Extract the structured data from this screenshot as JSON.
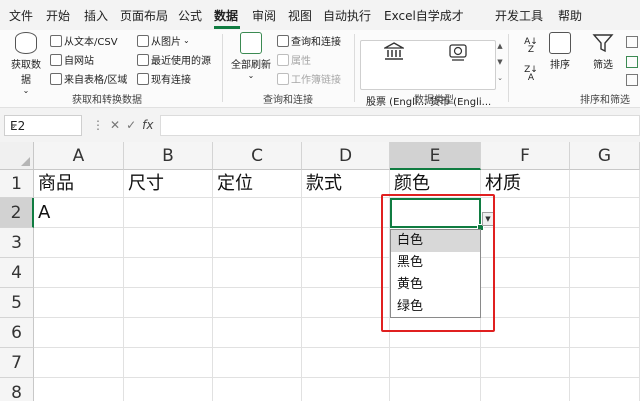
{
  "menu": {
    "tabs": [
      "文件",
      "开始",
      "插入",
      "页面布局",
      "公式",
      "数据",
      "审阅",
      "视图",
      "自动执行",
      "Excel自学成才",
      "开发工具",
      "帮助"
    ],
    "active_tab": "数据"
  },
  "ribbon": {
    "get_data": {
      "big_button": "获取数据",
      "from_text_csv": "从文本/CSV",
      "from_web": "自网站",
      "from_table": "来自表格/区域",
      "from_picture": "从图片",
      "recent_sources": "最近使用的源",
      "existing_connections": "现有连接",
      "group_label": "获取和转换数据"
    },
    "queries": {
      "refresh_all": "全部刷新",
      "queries_connections": "查询和连接",
      "properties": "属性",
      "workbook_links": "工作簿链接",
      "group_label": "查询和连接"
    },
    "data_types": {
      "stocks": "股票 (Engli...",
      "currencies": "货币 (Engli...",
      "group_label": "数据类型"
    },
    "sort_filter": {
      "sort": "排序",
      "filter": "筛选",
      "group_label": "排序和筛选"
    }
  },
  "formula_bar": {
    "name_box": "E2",
    "fx": "fx",
    "content": ""
  },
  "sheet": {
    "columns": [
      "A",
      "B",
      "C",
      "D",
      "E",
      "F",
      "G"
    ],
    "rows": [
      "1",
      "2",
      "3",
      "4",
      "5",
      "6",
      "7",
      "8"
    ],
    "header_row": [
      "商品",
      "尺寸",
      "定位",
      "款式",
      "颜色",
      "材质",
      ""
    ],
    "row2_a": "A",
    "selected_column": "E",
    "selected_row": "2"
  },
  "dropdown": {
    "options": [
      "白色",
      "黑色",
      "黄色",
      "绿色"
    ],
    "highlighted": "白色"
  },
  "colors": {
    "accent": "#107c41",
    "highlight_box": "#e02020"
  }
}
